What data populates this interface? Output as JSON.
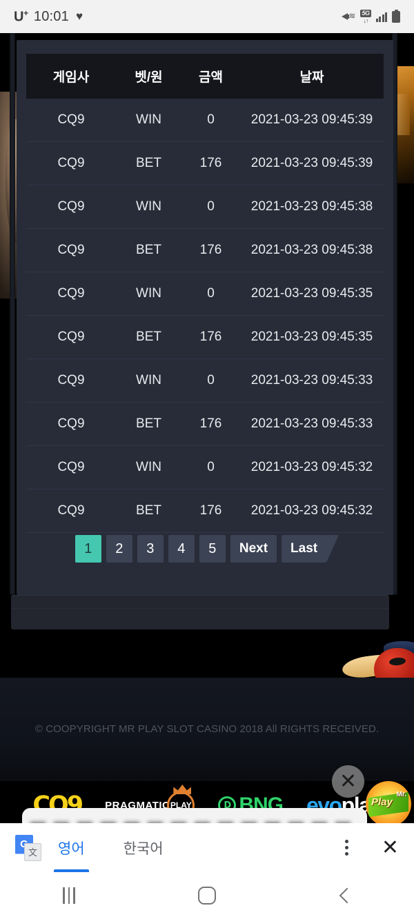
{
  "status_bar": {
    "carrier": "U",
    "carrier_sup": "+",
    "time": "10:01",
    "heart": "♥",
    "icons": [
      "mute-icon",
      "5g-network-icon",
      "signal-bars-icon",
      "battery-icon"
    ],
    "network_label": "5G"
  },
  "table": {
    "headers": [
      "게임사",
      "벳/원",
      "금액",
      "날짜"
    ],
    "rows": [
      {
        "vendor": "CQ9",
        "type": "WIN",
        "amount": "0",
        "date": "2021-03-23 09:45:39"
      },
      {
        "vendor": "CQ9",
        "type": "BET",
        "amount": "176",
        "date": "2021-03-23 09:45:39"
      },
      {
        "vendor": "CQ9",
        "type": "WIN",
        "amount": "0",
        "date": "2021-03-23 09:45:38"
      },
      {
        "vendor": "CQ9",
        "type": "BET",
        "amount": "176",
        "date": "2021-03-23 09:45:38"
      },
      {
        "vendor": "CQ9",
        "type": "WIN",
        "amount": "0",
        "date": "2021-03-23 09:45:35"
      },
      {
        "vendor": "CQ9",
        "type": "BET",
        "amount": "176",
        "date": "2021-03-23 09:45:35"
      },
      {
        "vendor": "CQ9",
        "type": "WIN",
        "amount": "0",
        "date": "2021-03-23 09:45:33"
      },
      {
        "vendor": "CQ9",
        "type": "BET",
        "amount": "176",
        "date": "2021-03-23 09:45:33"
      },
      {
        "vendor": "CQ9",
        "type": "WIN",
        "amount": "0",
        "date": "2021-03-23 09:45:32"
      },
      {
        "vendor": "CQ9",
        "type": "BET",
        "amount": "176",
        "date": "2021-03-23 09:45:32"
      }
    ]
  },
  "pagination": {
    "pages": [
      "1",
      "2",
      "3",
      "4",
      "5"
    ],
    "active_page": "1",
    "next_label": "Next",
    "last_label": "Last"
  },
  "footer": {
    "copyright": "© COOPYRIGHT MR PLAY SLOT CASINO 2018 All RIGHTS RECEIVED.",
    "logos": [
      {
        "name": "cq9",
        "text": "CQ9"
      },
      {
        "name": "pragmatic-play",
        "text": "PRAGMATIC",
        "mark": "PLAY"
      },
      {
        "name": "bng",
        "text": "BNG",
        "mark": "Ⅾ"
      },
      {
        "name": "evoplay",
        "text": "evo",
        "mark": "play"
      }
    ]
  },
  "ad_overlay": {
    "close_label": "✕",
    "badge_text": "Play",
    "badge_prefix": "Mr."
  },
  "translate_bar": {
    "icon": "google-translate-icon",
    "icon_g": "G",
    "icon_cjk": "文",
    "tabs": [
      {
        "label": "영어",
        "active": true
      },
      {
        "label": "한국어",
        "active": false
      }
    ],
    "menu_label": "⋮",
    "close_label": "✕"
  },
  "nav_bar": {
    "recents_label": "recents",
    "home_label": "home",
    "back_label": "back"
  },
  "colors": {
    "accent_teal": "#45c7b0",
    "card_bg": "#272c38",
    "header_bg": "#14161c",
    "pager_bg": "#3c4354",
    "google_blue": "#1a73e8"
  }
}
